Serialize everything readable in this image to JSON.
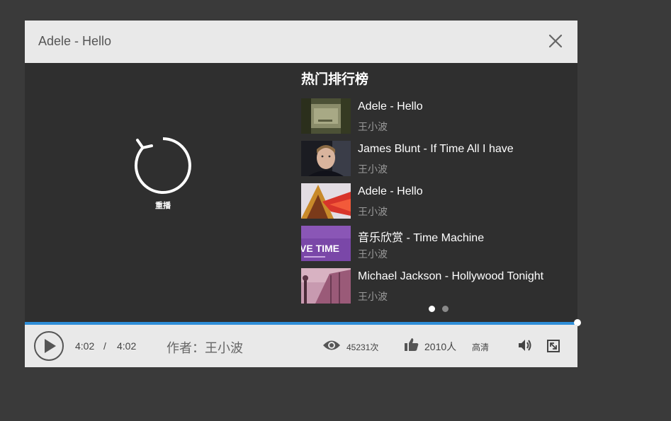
{
  "window": {
    "title": "Adele - Hello"
  },
  "overlay": {
    "replay_label": "重播"
  },
  "ranking": {
    "title": "热门排行榜",
    "items": [
      {
        "title": "Adele - Hello",
        "author": "王小波",
        "thumb_text": ""
      },
      {
        "title": "James Blunt - If Time All I have",
        "author": "王小波",
        "thumb_text": ""
      },
      {
        "title": "Adele - Hello",
        "author": "王小波",
        "thumb_text": ""
      },
      {
        "title": "音乐欣赏 - Time Machine",
        "author": "王小波",
        "thumb_text": "VE TIME"
      },
      {
        "title": "Michael Jackson - Hollywood Tonight",
        "author": "王小波",
        "thumb_text": ""
      }
    ],
    "pagination": {
      "pages": 2,
      "current": 1
    }
  },
  "progress": {
    "fraction": 1.0
  },
  "controls": {
    "current_time": "4:02",
    "separator": "/",
    "total_time": "4:02",
    "author_label": "作者：王小波",
    "views": "45231次",
    "likes": "2010人",
    "quality": "高清"
  },
  "icons": {
    "close": "close-icon",
    "replay": "replay-icon",
    "play": "play-icon",
    "views": "eye-icon",
    "likes": "thumbs-up-icon",
    "volume": "volume-icon",
    "fullscreen": "fullscreen-icon"
  },
  "colors": {
    "accent": "#2e8ed8",
    "video_bg": "#2f2f2f",
    "bar_bg": "#e9e9e9",
    "page_bg": "#3a3a3a",
    "dot_active": "#ffffff",
    "dot_inactive": "#8a8a8a"
  }
}
